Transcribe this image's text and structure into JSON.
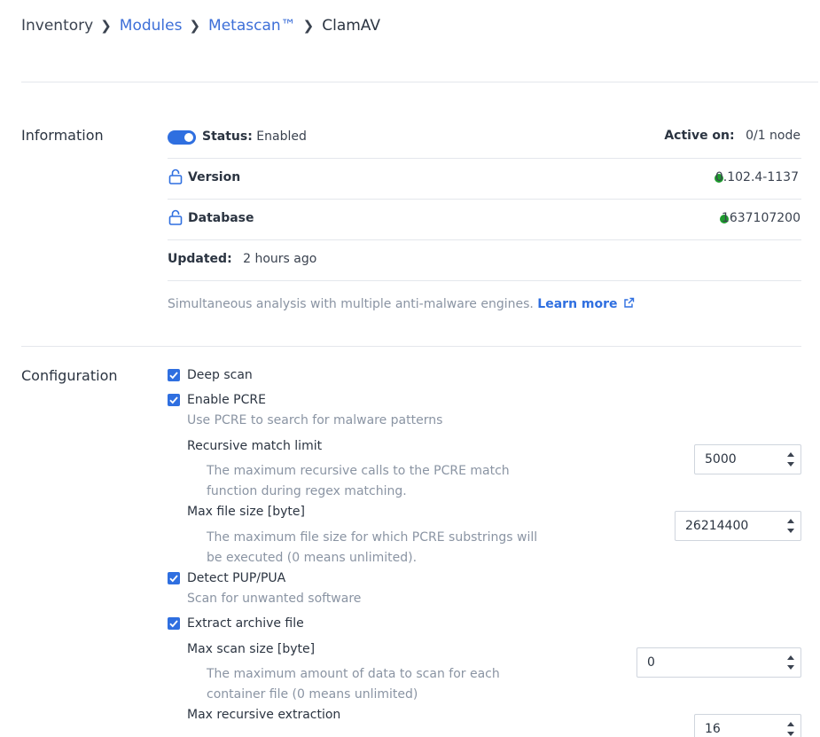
{
  "breadcrumb": {
    "items": [
      "Inventory",
      "Modules",
      "Metascan™",
      "ClamAV"
    ]
  },
  "information": {
    "title": "Information",
    "status_label": "Status:",
    "status_value": "Enabled",
    "active_on_label": "Active on:",
    "active_on_value": "0/1 node",
    "version_label": "Version",
    "version_value": "0.102.4-1137",
    "database_label": "Database",
    "database_value": "1637107200",
    "updated_label": "Updated:",
    "updated_value": "2 hours ago",
    "description": "Simultaneous analysis with multiple anti-malware engines.",
    "learn_more": "Learn more"
  },
  "configuration": {
    "title": "Configuration",
    "deep_scan": "Deep scan",
    "enable_pcre": "Enable PCRE",
    "enable_pcre_desc": "Use PCRE to search for malware patterns",
    "recursive_match_limit_label": "Recursive match limit",
    "recursive_match_limit_desc": "The maximum recursive calls to the PCRE match function during regex matching.",
    "recursive_match_limit_value": "5000",
    "max_file_size_label": "Max file size [byte]",
    "max_file_size_desc": "The maximum file size for which PCRE substrings will be executed (0 means unlimited).",
    "max_file_size_value": "26214400",
    "detect_pup": "Detect PUP/PUA",
    "detect_pup_desc": "Scan for unwanted software",
    "extract_archive": "Extract archive file",
    "max_scan_size_label": "Max scan size [byte]",
    "max_scan_size_desc": "The maximum amount of data to scan for each container file (0 means unlimited)",
    "max_scan_size_value": "0",
    "max_recursive_extraction_label": "Max recursive extraction",
    "max_recursive_extraction_value": "16"
  },
  "colors": {
    "accent": "#2f6fe0",
    "status_ok": "#1e9b2e",
    "muted": "#8a94a3"
  },
  "icons": [
    "chevron-right-icon",
    "toggle-switch",
    "unlock-icon",
    "status-dot",
    "external-link-icon",
    "checkbox-checked-icon",
    "spinner-arrows"
  ]
}
